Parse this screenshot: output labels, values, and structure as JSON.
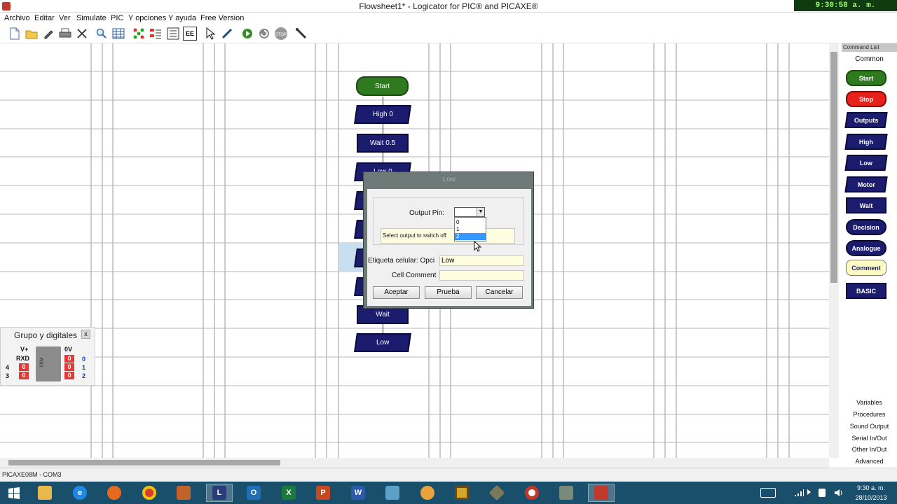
{
  "window": {
    "title": "Flowsheet1* - Logicator for PIC® and PICAXE®",
    "clock": "9:30:58 a. m. 10/28/2013"
  },
  "menu": [
    "Archivo",
    "Editar",
    "Ver",
    "Simulate",
    "PIC",
    "Y opciones",
    "Y ayuda",
    "Free Version"
  ],
  "toolbar": {
    "icons": [
      "new-file-icon",
      "open-folder-icon",
      "pencil-icon",
      "print-icon",
      "scissors-icon",
      "zoom-icon",
      "grid-icon",
      "flow-icon",
      "variables-icon",
      "list-icon",
      "ee-icon",
      "pointer-icon",
      "draw-line-icon",
      "run-icon",
      "refresh-icon",
      "stop-icon",
      "probe-icon"
    ],
    "ee_label": "EE",
    "stop_label": "STOP"
  },
  "flowchart": {
    "cells": [
      {
        "label": "Start",
        "kind": "start"
      },
      {
        "label": "High 0",
        "kind": "para"
      },
      {
        "label": "Wait 0.5",
        "kind": "cmd"
      },
      {
        "label": "Low 0",
        "kind": "para"
      },
      {
        "label": "",
        "kind": "para"
      },
      {
        "label": "",
        "kind": "para"
      },
      {
        "label": "",
        "kind": "para"
      },
      {
        "label": "",
        "kind": "para"
      },
      {
        "label": "Wait",
        "kind": "cmd"
      },
      {
        "label": "Low",
        "kind": "para"
      }
    ]
  },
  "pins_panel": {
    "title": "Grupo y digitales",
    "close": "x",
    "top_left": "V+",
    "top_right": "0V",
    "rxd": "RXD",
    "chip_label": "08M",
    "left_numbers": [
      "4",
      "3"
    ],
    "right_numbers": [
      "0",
      "1",
      "2"
    ],
    "states": [
      "0",
      "0",
      "0",
      "0",
      "0",
      "0",
      "0"
    ]
  },
  "dialog": {
    "title": "Low",
    "output_pin_label": "Output Pin:",
    "output_pin_value": "",
    "pin_options": [
      "0",
      "1",
      "2"
    ],
    "selected_option": "2",
    "hint": "Select output to switch off",
    "cell_label_label": "Etiqueta celular: Opci",
    "cell_label_value": "Low",
    "cell_comment_label": "Cell Comment",
    "cell_comment_value": "",
    "buttons": {
      "ok": "Aceptar",
      "test": "Prueba",
      "cancel": "Cancelar"
    }
  },
  "command_list": {
    "title": "Command List",
    "section": "Common",
    "commands": [
      "Start",
      "Stop",
      "Outputs",
      "High",
      "Low",
      "Motor",
      "Wait",
      "Decision",
      "Analogue",
      "Comment",
      "BASIC"
    ],
    "categories": [
      "Variables",
      "Procedures",
      "Sound Output",
      "Serial In/Out",
      "Other In/Out",
      "Advanced"
    ]
  },
  "status": {
    "text": "PICAXE08M - COM3"
  },
  "taskbar": {
    "apps": [
      "windows-start",
      "file-explorer",
      "internet-explorer",
      "firefox",
      "chrome",
      "paint",
      "logicator",
      "outlook",
      "excel",
      "powerpoint",
      "word",
      "notepad",
      "game-app",
      "app-square",
      "app-diamond",
      "recorder",
      "app-gray",
      "app-red"
    ],
    "letters": {
      "logicator": "L",
      "outlook": "O",
      "excel": "X",
      "powerpoint": "P",
      "word": "W"
    },
    "time": "9:30 a. m.",
    "date": "28/10/2013"
  },
  "colors": {
    "start": "#2f7a1f",
    "stop": "#e8221a",
    "command": "#1c1c6e",
    "comment": "#fffbc4",
    "pin_on": "#e53935",
    "selection": "#3399ff"
  }
}
